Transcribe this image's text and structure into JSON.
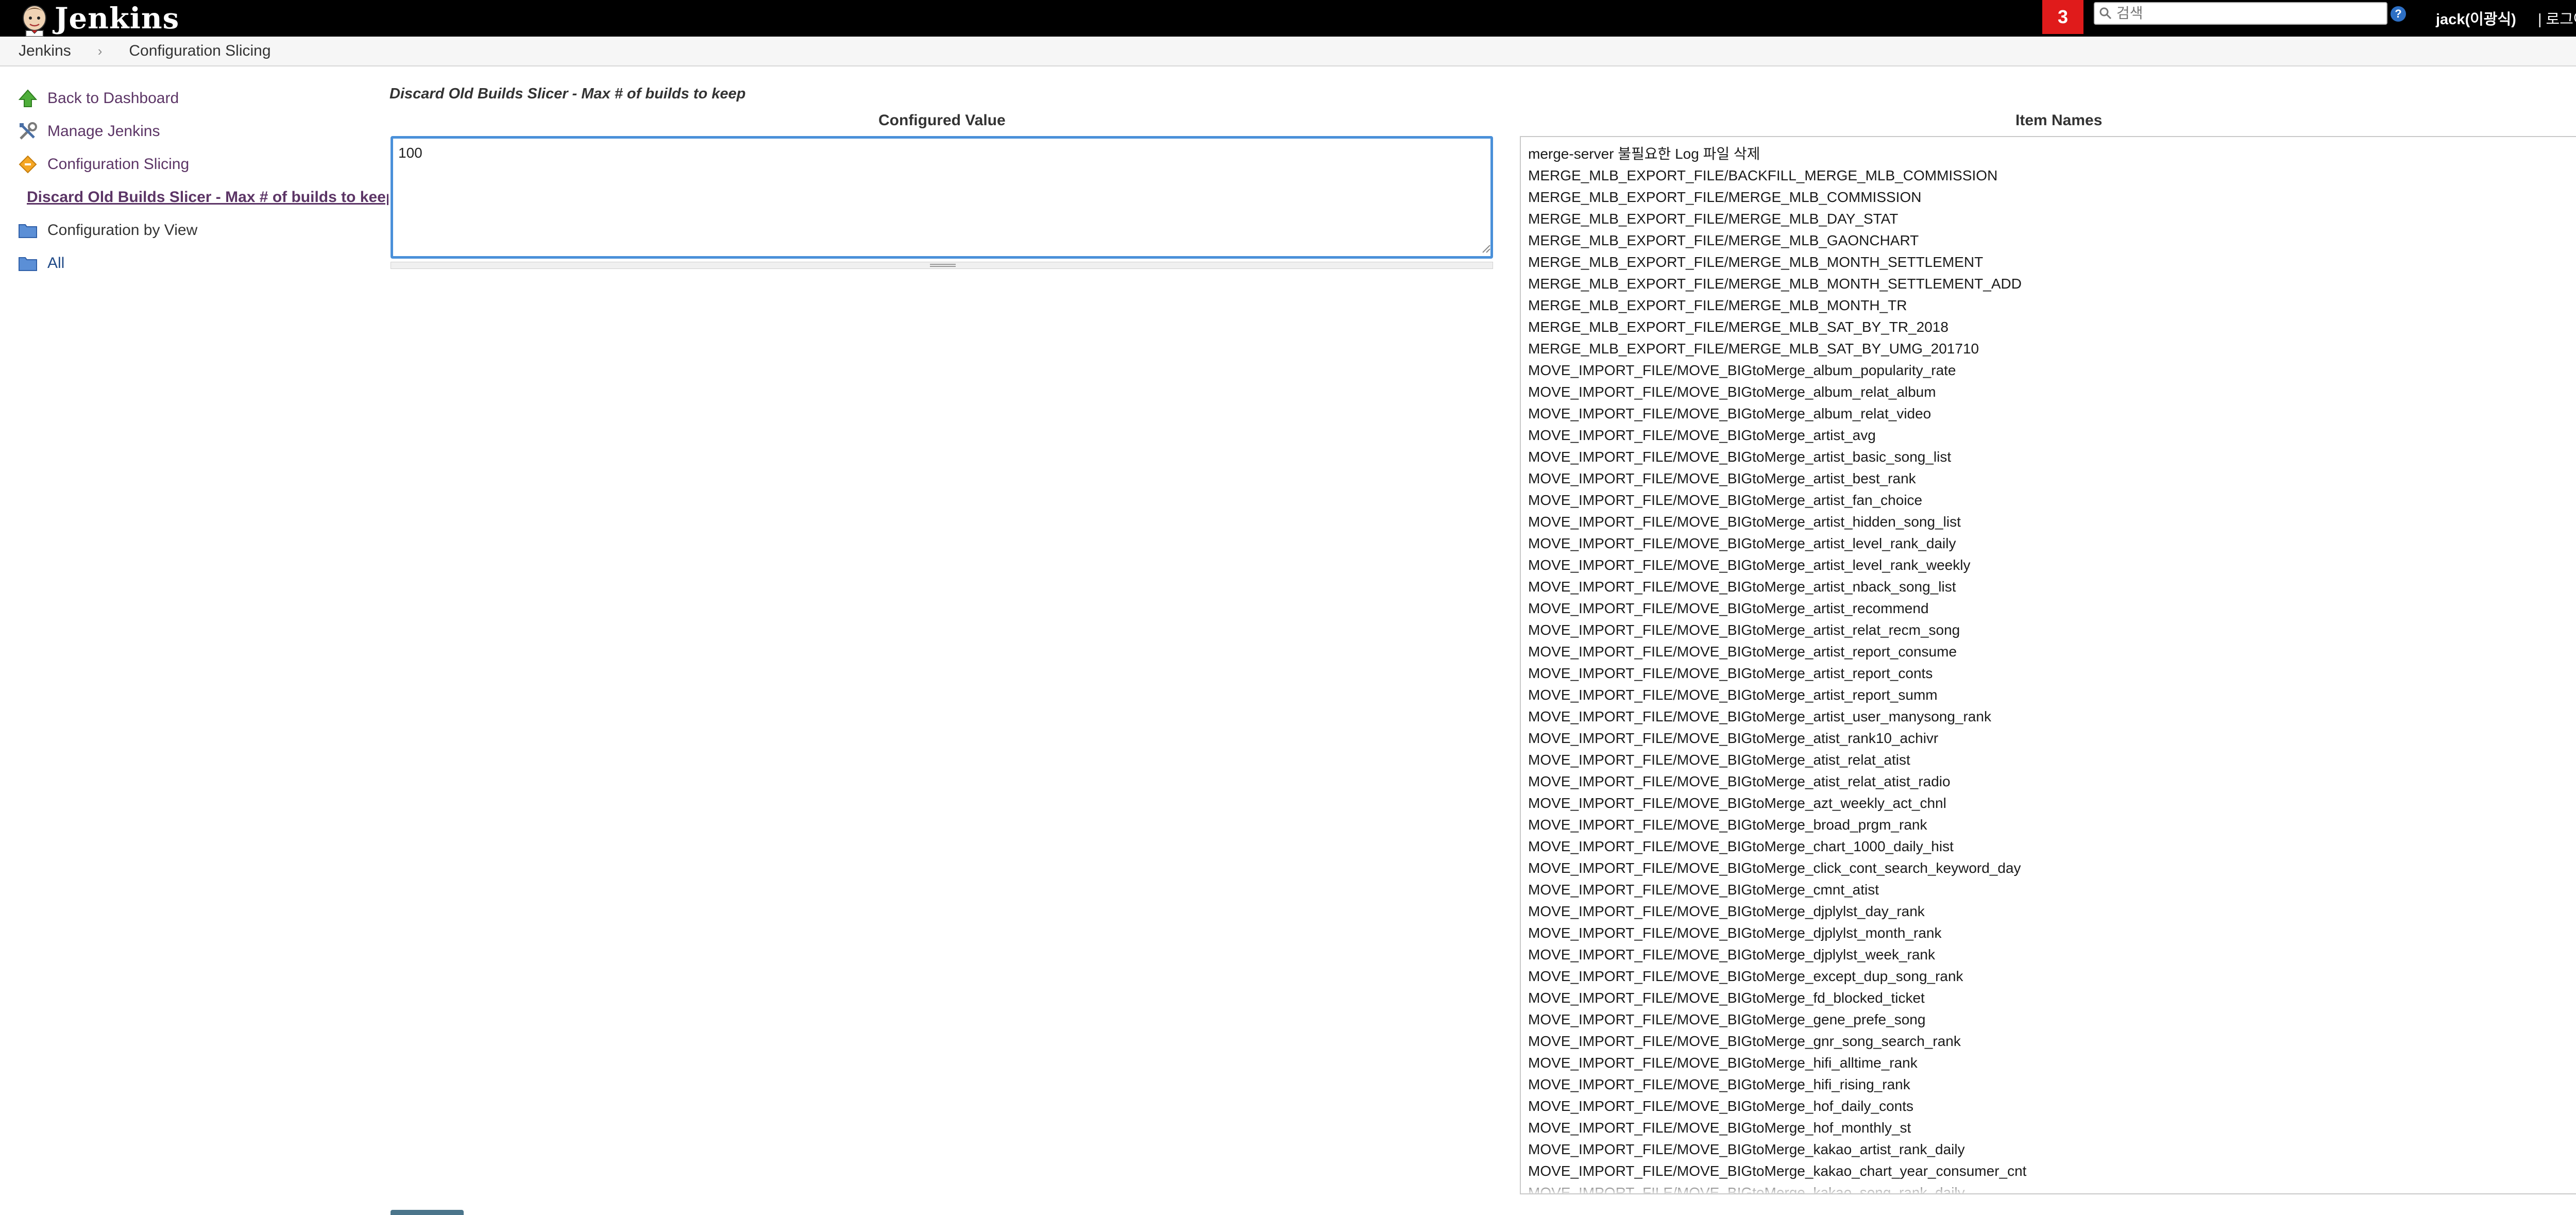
{
  "header": {
    "logo_text": "Jenkins",
    "notification_count": "3",
    "search_placeholder": "검색",
    "help_label": "?",
    "user": "jack(이광식)",
    "logout_sep": "|",
    "logout": "로그아웃"
  },
  "breadcrumb": {
    "items": [
      "Jenkins",
      "Configuration Slicing"
    ],
    "separator": "›"
  },
  "sidepanel": {
    "tasks": [
      {
        "label": "Back to Dashboard",
        "icon": "up-arrow-icon"
      },
      {
        "label": "Manage Jenkins",
        "icon": "tools-icon"
      },
      {
        "label": "Configuration Slicing",
        "icon": "slicing-icon"
      },
      {
        "label": "Discard Old Builds Slicer - Max # of builds to keep",
        "icon": "slicing-icon"
      },
      {
        "label": "Configuration by View",
        "icon": "folder-icon"
      },
      {
        "label": "All",
        "icon": "folder-icon"
      }
    ]
  },
  "main": {
    "heading": "Discard Old Builds Slicer - Max # of builds to keep",
    "configured_value_header": "Configured Value",
    "configured_value": "100",
    "item_names_header": "Item Names",
    "item_names": [
      "merge-server 불필요한 Log 파일 삭제",
      "MERGE_MLB_EXPORT_FILE/BACKFILL_MERGE_MLB_COMMISSION",
      "MERGE_MLB_EXPORT_FILE/MERGE_MLB_COMMISSION",
      "MERGE_MLB_EXPORT_FILE/MERGE_MLB_DAY_STAT",
      "MERGE_MLB_EXPORT_FILE/MERGE_MLB_GAONCHART",
      "MERGE_MLB_EXPORT_FILE/MERGE_MLB_MONTH_SETTLEMENT",
      "MERGE_MLB_EXPORT_FILE/MERGE_MLB_MONTH_SETTLEMENT_ADD",
      "MERGE_MLB_EXPORT_FILE/MERGE_MLB_MONTH_TR",
      "MERGE_MLB_EXPORT_FILE/MERGE_MLB_SAT_BY_TR_2018",
      "MERGE_MLB_EXPORT_FILE/MERGE_MLB_SAT_BY_UMG_201710",
      "MOVE_IMPORT_FILE/MOVE_BIGtoMerge_album_popularity_rate",
      "MOVE_IMPORT_FILE/MOVE_BIGtoMerge_album_relat_album",
      "MOVE_IMPORT_FILE/MOVE_BIGtoMerge_album_relat_video",
      "MOVE_IMPORT_FILE/MOVE_BIGtoMerge_artist_avg",
      "MOVE_IMPORT_FILE/MOVE_BIGtoMerge_artist_basic_song_list",
      "MOVE_IMPORT_FILE/MOVE_BIGtoMerge_artist_best_rank",
      "MOVE_IMPORT_FILE/MOVE_BIGtoMerge_artist_fan_choice",
      "MOVE_IMPORT_FILE/MOVE_BIGtoMerge_artist_hidden_song_list",
      "MOVE_IMPORT_FILE/MOVE_BIGtoMerge_artist_level_rank_daily",
      "MOVE_IMPORT_FILE/MOVE_BIGtoMerge_artist_level_rank_weekly",
      "MOVE_IMPORT_FILE/MOVE_BIGtoMerge_artist_nback_song_list",
      "MOVE_IMPORT_FILE/MOVE_BIGtoMerge_artist_recommend",
      "MOVE_IMPORT_FILE/MOVE_BIGtoMerge_artist_relat_recm_song",
      "MOVE_IMPORT_FILE/MOVE_BIGtoMerge_artist_report_consume",
      "MOVE_IMPORT_FILE/MOVE_BIGtoMerge_artist_report_conts",
      "MOVE_IMPORT_FILE/MOVE_BIGtoMerge_artist_report_summ",
      "MOVE_IMPORT_FILE/MOVE_BIGtoMerge_artist_user_manysong_rank",
      "MOVE_IMPORT_FILE/MOVE_BIGtoMerge_atist_rank10_achivr",
      "MOVE_IMPORT_FILE/MOVE_BIGtoMerge_atist_relat_atist",
      "MOVE_IMPORT_FILE/MOVE_BIGtoMerge_atist_relat_atist_radio",
      "MOVE_IMPORT_FILE/MOVE_BIGtoMerge_azt_weekly_act_chnl",
      "MOVE_IMPORT_FILE/MOVE_BIGtoMerge_broad_prgm_rank",
      "MOVE_IMPORT_FILE/MOVE_BIGtoMerge_chart_1000_daily_hist",
      "MOVE_IMPORT_FILE/MOVE_BIGtoMerge_click_cont_search_keyword_day",
      "MOVE_IMPORT_FILE/MOVE_BIGtoMerge_cmnt_atist",
      "MOVE_IMPORT_FILE/MOVE_BIGtoMerge_djplylst_day_rank",
      "MOVE_IMPORT_FILE/MOVE_BIGtoMerge_djplylst_month_rank",
      "MOVE_IMPORT_FILE/MOVE_BIGtoMerge_djplylst_week_rank",
      "MOVE_IMPORT_FILE/MOVE_BIGtoMerge_except_dup_song_rank",
      "MOVE_IMPORT_FILE/MOVE_BIGtoMerge_fd_blocked_ticket",
      "MOVE_IMPORT_FILE/MOVE_BIGtoMerge_gene_prefe_song",
      "MOVE_IMPORT_FILE/MOVE_BIGtoMerge_gnr_song_search_rank",
      "MOVE_IMPORT_FILE/MOVE_BIGtoMerge_hifi_alltime_rank",
      "MOVE_IMPORT_FILE/MOVE_BIGtoMerge_hifi_rising_rank",
      "MOVE_IMPORT_FILE/MOVE_BIGtoMerge_hof_daily_conts",
      "MOVE_IMPORT_FILE/MOVE_BIGtoMerge_hof_monthly_st",
      "MOVE_IMPORT_FILE/MOVE_BIGtoMerge_kakao_artist_rank_daily",
      "MOVE_IMPORT_FILE/MOVE_BIGtoMerge_kakao_chart_year_consumer_cnt",
      "MOVE_IMPORT_FILE/MOVE_BIGtoMerge_kakao_song_rank_daily"
    ]
  },
  "colors": {
    "header_bg": "#000000",
    "badge_bg": "#e01b1b",
    "link": "#5c3566",
    "focus_border": "#4a90d9"
  }
}
